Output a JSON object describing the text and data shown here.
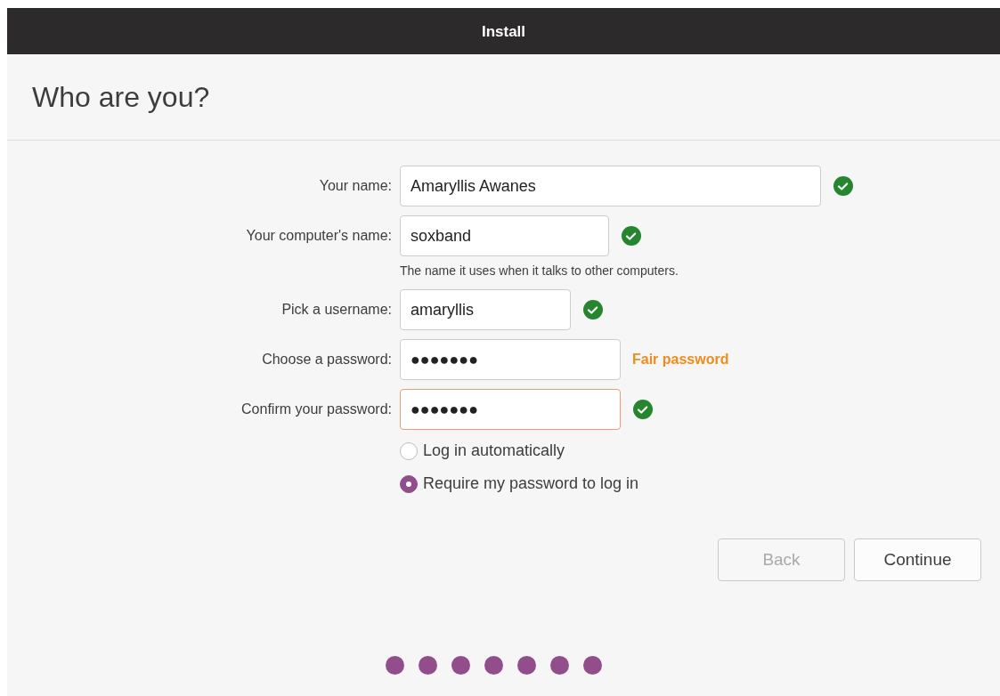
{
  "window": {
    "title": "Install"
  },
  "heading": "Who are you?",
  "fields": [
    {
      "label": "Your name:",
      "value": "Amaryllis Awanes",
      "valid": true,
      "focused": false
    },
    {
      "label": "Your computer's name:",
      "value": "soxband",
      "valid": true,
      "focused": false,
      "hint": "The name it uses when it talks to other computers."
    },
    {
      "label": "Pick a username:",
      "value": "amaryllis",
      "valid": true,
      "focused": false
    },
    {
      "label": "Choose a password:",
      "value": "●●●●●●●",
      "valid": false,
      "focused": false,
      "strength": "Fair password"
    },
    {
      "label": "Confirm your password:",
      "value": "●●●●●●●",
      "valid": true,
      "focused": true
    }
  ],
  "login_options": [
    {
      "label": "Log in automatically",
      "selected": false
    },
    {
      "label": "Require my password to log in",
      "selected": true
    }
  ],
  "buttons": [
    {
      "label": "Back",
      "disabled": true
    },
    {
      "label": "Continue",
      "disabled": false
    }
  ],
  "progress": [
    {
      "done": true
    },
    {
      "done": true
    },
    {
      "done": true
    },
    {
      "done": true
    },
    {
      "done": true
    },
    {
      "done": true
    },
    {
      "done": true
    }
  ]
}
